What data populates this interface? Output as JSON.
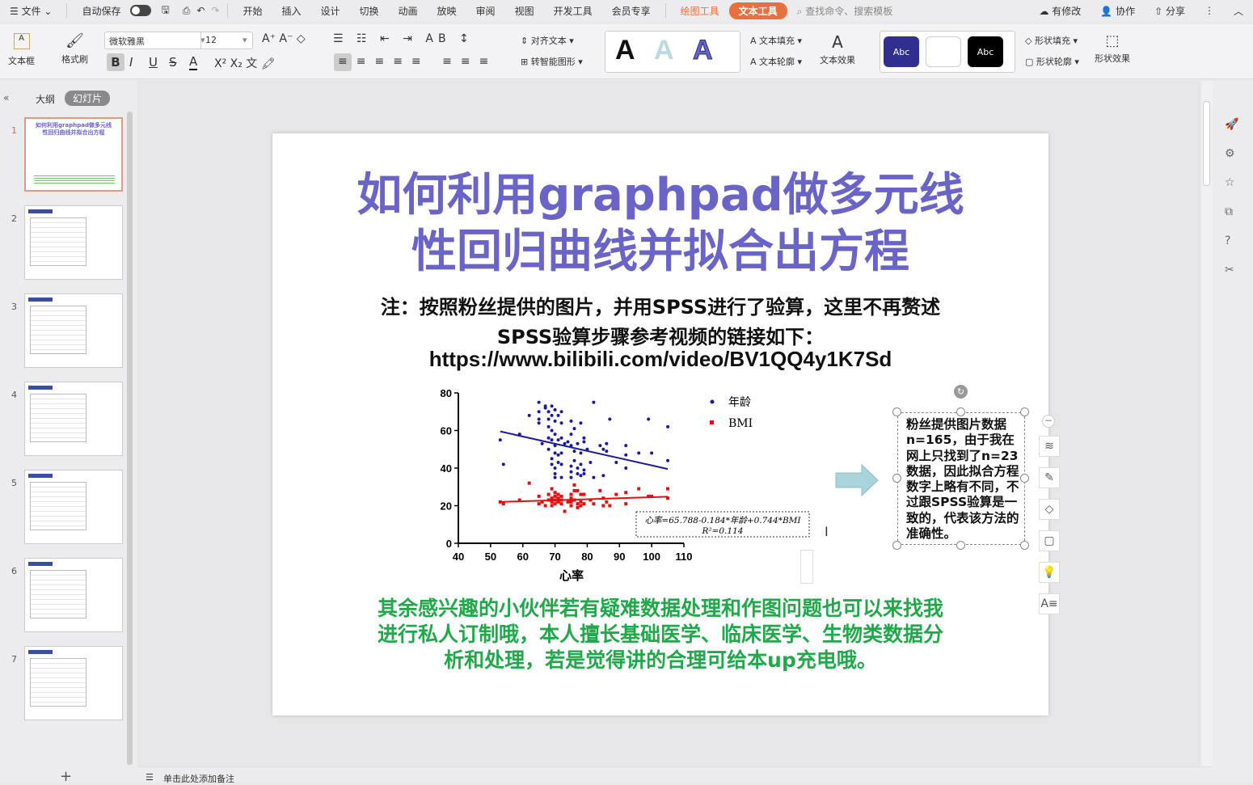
{
  "menubar": {
    "file": "文件",
    "autosave": "自动保存",
    "tabs": [
      "开始",
      "插入",
      "设计",
      "切换",
      "动画",
      "放映",
      "审阅",
      "视图",
      "开发工具",
      "会员专享"
    ],
    "draw_tool": "绘图工具",
    "text_tool": "文本工具",
    "search": "查找命令、搜索模板",
    "modified": "有修改",
    "collab": "协作",
    "share": "分享"
  },
  "ribbon": {
    "textbox": "文本框",
    "format_painter": "格式刷",
    "font": "微软雅黑",
    "size": "12",
    "align_text": "对齐文本",
    "smart_shape": "转智能图形",
    "text_fill": "文本填充",
    "text_outline": "文本轮廓",
    "text_effect": "文本效果",
    "shape_fill": "形状填充",
    "shape_outline": "形状轮廓",
    "shape_effect": "形状效果",
    "abc": "Abc",
    "bold": "B",
    "italic": "I",
    "underline": "U",
    "strike": "S",
    "fontcolor": "A"
  },
  "panel": {
    "outline_tab": "大纲",
    "slides_tab": "幻灯片",
    "slide_numbers": [
      "1",
      "2",
      "3",
      "4",
      "5",
      "6",
      "7"
    ],
    "thumb1_title": "如何利用graphpad做多元线性回归曲线并拟合出方程"
  },
  "slide": {
    "title_line1": "如何利用graphpad做多元线",
    "title_line2": "性回归曲线并拟合出方程",
    "note1": "注：按照粉丝提供的图片，并用SPSS进行了验算，这里不再赘述",
    "note2": "SPSS验算步骤参考视频的链接如下：",
    "note3": "https://www.bilibili.com/video/BV1QQ4y1K7Sd",
    "callout": "粉丝提供图片数据n=165，由于我在网上只找到了n=23数据，因此拟合方程数字上略有不同，不过跟SPSS验算是一致的，代表该方法的准确性。",
    "green1": "其余感兴趣的小伙伴若有疑难数据处理和作图问题也可以来找我",
    "green2": "进行私人订制哦，本人擅长基础医学、临床医学、生物类数据分",
    "green3": "析和处理，若是觉得讲的合理可给本up充电哦。"
  },
  "notes": {
    "placeholder": "单击此处添加备注"
  },
  "chart_data": {
    "type": "scatter",
    "xlabel": "心率",
    "ylabel": "",
    "xlim": [
      40,
      110
    ],
    "ylim": [
      0,
      80
    ],
    "xticks": [
      "40",
      "50",
      "60",
      "70",
      "80",
      "90",
      "100",
      "110"
    ],
    "yticks": [
      "0",
      "20",
      "40",
      "60",
      "80"
    ],
    "legend_position": "top-right",
    "equation": "心率=65.788-0.184*年龄+0.744*BMI",
    "r2": "R²=0.114",
    "colors": {
      "年龄": "#1a1a9e",
      "BMI": "#e01010"
    },
    "series": [
      {
        "name": "年龄",
        "trend": [
          [
            53,
            59.5
          ],
          [
            105,
            39.5
          ]
        ],
        "points": [
          [
            53,
            55
          ],
          [
            54,
            42
          ],
          [
            59,
            58
          ],
          [
            62,
            68
          ],
          [
            65,
            75
          ],
          [
            65,
            70
          ],
          [
            65,
            66
          ],
          [
            65,
            64
          ],
          [
            66,
            53
          ],
          [
            67,
            73
          ],
          [
            67,
            72
          ],
          [
            68,
            70
          ],
          [
            68,
            66
          ],
          [
            68,
            62
          ],
          [
            68,
            56
          ],
          [
            68,
            50
          ],
          [
            69,
            73
          ],
          [
            69,
            68
          ],
          [
            69,
            60
          ],
          [
            69,
            55
          ],
          [
            69,
            45
          ],
          [
            69,
            42
          ],
          [
            70,
            71
          ],
          [
            70,
            65
          ],
          [
            70,
            58
          ],
          [
            70,
            52
          ],
          [
            70,
            48
          ],
          [
            70,
            40
          ],
          [
            70,
            37
          ],
          [
            70,
            35
          ],
          [
            71,
            68
          ],
          [
            71,
            55
          ],
          [
            71,
            47
          ],
          [
            71,
            43
          ],
          [
            72,
            70
          ],
          [
            72,
            64
          ],
          [
            72,
            56
          ],
          [
            72,
            48
          ],
          [
            72,
            42
          ],
          [
            72,
            35
          ],
          [
            73,
            53
          ],
          [
            74,
            54
          ],
          [
            75,
            65
          ],
          [
            75,
            58
          ],
          [
            75,
            52
          ],
          [
            75,
            41
          ],
          [
            75,
            38
          ],
          [
            75,
            35
          ],
          [
            76,
            61
          ],
          [
            76,
            49
          ],
          [
            76,
            44
          ],
          [
            77,
            53
          ],
          [
            77,
            40
          ],
          [
            77,
            37
          ],
          [
            78,
            64
          ],
          [
            78,
            48
          ],
          [
            78,
            42
          ],
          [
            78,
            36
          ],
          [
            79,
            56
          ],
          [
            79,
            54
          ],
          [
            79,
            39
          ],
          [
            79,
            37
          ],
          [
            80,
            50
          ],
          [
            81,
            43
          ],
          [
            82,
            75
          ],
          [
            82,
            35
          ],
          [
            84,
            52
          ],
          [
            85,
            50
          ],
          [
            85,
            36
          ],
          [
            86,
            53
          ],
          [
            86,
            49
          ],
          [
            87,
            66
          ],
          [
            89,
            43
          ],
          [
            92,
            52
          ],
          [
            92,
            47
          ],
          [
            92,
            40
          ],
          [
            96,
            48
          ],
          [
            99,
            66
          ],
          [
            100,
            48
          ],
          [
            105,
            62
          ],
          [
            105,
            44
          ]
        ]
      },
      {
        "name": "BMI",
        "trend": [
          [
            53,
            22
          ],
          [
            105,
            24.8
          ]
        ],
        "points": [
          [
            53,
            22
          ],
          [
            54,
            21
          ],
          [
            59,
            23
          ],
          [
            62,
            32
          ],
          [
            65,
            25
          ],
          [
            65,
            21
          ],
          [
            66,
            22
          ],
          [
            67,
            20
          ],
          [
            68,
            26
          ],
          [
            68,
            23
          ],
          [
            69,
            29
          ],
          [
            69,
            24
          ],
          [
            69,
            22
          ],
          [
            69,
            20
          ],
          [
            70,
            27
          ],
          [
            70,
            25
          ],
          [
            70,
            23
          ],
          [
            70,
            21
          ],
          [
            71,
            26
          ],
          [
            71,
            24
          ],
          [
            71,
            22
          ],
          [
            72,
            25
          ],
          [
            72,
            23
          ],
          [
            72,
            21
          ],
          [
            73,
            17
          ],
          [
            74,
            22
          ],
          [
            75,
            26
          ],
          [
            75,
            24
          ],
          [
            75,
            22
          ],
          [
            75,
            20
          ],
          [
            76,
            31
          ],
          [
            76,
            28
          ],
          [
            76,
            23
          ],
          [
            77,
            28
          ],
          [
            77,
            19
          ],
          [
            77,
            21
          ],
          [
            78,
            26
          ],
          [
            78,
            22
          ],
          [
            78,
            20
          ],
          [
            79,
            26
          ],
          [
            79,
            21
          ],
          [
            81,
            23
          ],
          [
            82,
            21
          ],
          [
            84,
            28
          ],
          [
            85,
            24
          ],
          [
            85,
            20
          ],
          [
            86,
            22
          ],
          [
            87,
            20
          ],
          [
            89,
            26
          ],
          [
            92,
            27
          ],
          [
            92,
            21
          ],
          [
            96,
            29
          ],
          [
            99,
            25
          ],
          [
            100,
            25
          ],
          [
            105,
            29
          ],
          [
            105,
            24
          ]
        ]
      }
    ]
  }
}
